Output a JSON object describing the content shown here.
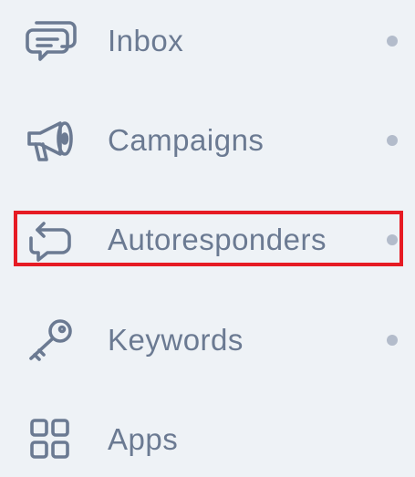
{
  "nav": {
    "items": [
      {
        "id": "inbox",
        "label": "Inbox",
        "icon": "chat-bubbles-icon",
        "has_dot": true
      },
      {
        "id": "campaigns",
        "label": "Campaigns",
        "icon": "megaphone-icon",
        "has_dot": true
      },
      {
        "id": "autoresponders",
        "label": "Autoresponders",
        "icon": "reply-bubble-icon",
        "has_dot": true,
        "highlighted": true
      },
      {
        "id": "keywords",
        "label": "Keywords",
        "icon": "key-icon",
        "has_dot": true
      },
      {
        "id": "apps",
        "label": "Apps",
        "icon": "grid-icon",
        "has_dot": false
      }
    ]
  },
  "colors": {
    "background": "#eef2f6",
    "text": "#6b7a92",
    "icon_stroke": "#6b7a92",
    "dot": "#b3bccb",
    "highlight_border": "#e61b24"
  }
}
